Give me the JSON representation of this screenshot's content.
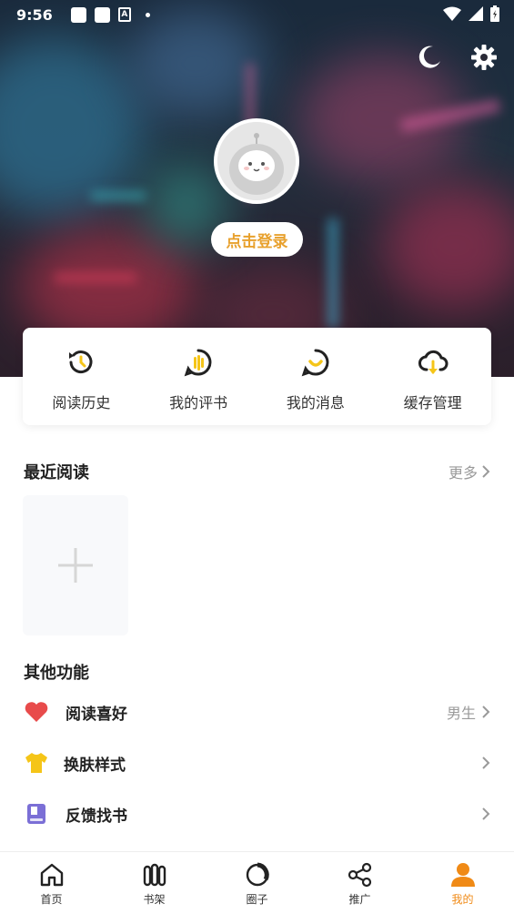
{
  "status_bar": {
    "time": "9:56"
  },
  "header": {
    "login_label": "点击登录"
  },
  "quick_actions": [
    {
      "label": "阅读历史",
      "icon": "history-icon"
    },
    {
      "label": "我的评书",
      "icon": "comment-icon"
    },
    {
      "label": "我的消息",
      "icon": "message-icon"
    },
    {
      "label": "缓存管理",
      "icon": "cloud-download-icon"
    }
  ],
  "recent": {
    "title": "最近阅读",
    "more_label": "更多"
  },
  "other": {
    "title": "其他功能",
    "items": [
      {
        "label": "阅读喜好",
        "value": "男生",
        "icon": "heart-icon"
      },
      {
        "label": "换肤样式",
        "value": "",
        "icon": "tshirt-icon"
      },
      {
        "label": "反馈找书",
        "value": "",
        "icon": "book-icon"
      }
    ]
  },
  "bottom_nav": [
    {
      "label": "首页",
      "icon": "home-icon"
    },
    {
      "label": "书架",
      "icon": "bookshelf-icon"
    },
    {
      "label": "圈子",
      "icon": "circle-icon"
    },
    {
      "label": "推广",
      "icon": "share-icon"
    },
    {
      "label": "我的",
      "icon": "profile-icon",
      "active": true
    }
  ],
  "colors": {
    "accent": "#f08a16",
    "login_text": "#e8a12e",
    "quick_icon_yellow": "#f5c518",
    "heart": "#e84b4b",
    "tshirt": "#f5c518",
    "book": "#7b6fd6"
  }
}
